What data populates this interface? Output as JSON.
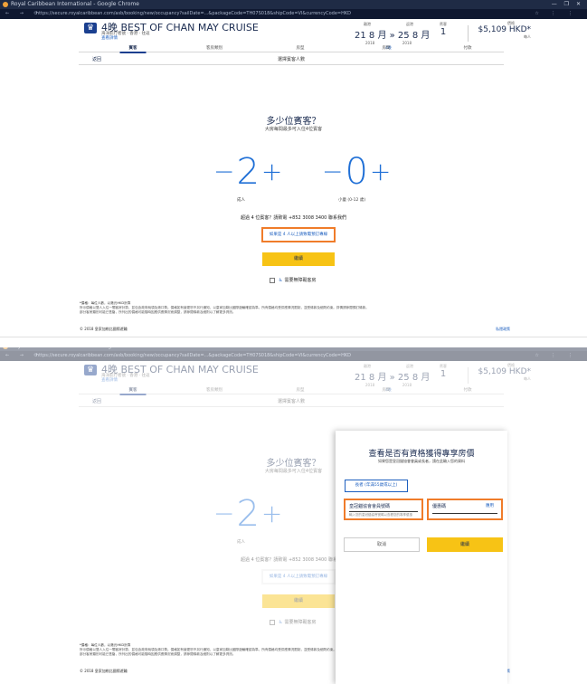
{
  "browser": {
    "window_title": "Royal Caribbean International - Google Chrome",
    "window_controls": "— ❐ ✕",
    "nav_glyphs": "← → ⟳",
    "url": "https://secure.royalcaribbean.com/asb/booking/new/occupancy?sailDate=...&packageCode=TH07S018&shipCode=VI&currencyCode=HKD",
    "address_icons": "☆ ⋮ ⋮"
  },
  "header": {
    "logo_glyph": "♛",
    "cruise_name": "4晚 BEST OF CHAN MAY CRUISE",
    "cruise_sub": "海洋航行者號 · 香港 · 往返",
    "details_link": "查看詳情",
    "date_labels": [
      "離港",
      "返港"
    ],
    "date_range": "21 8 月  »  25 8 月",
    "years": [
      "2018",
      "2018"
    ],
    "nights": "4晚",
    "guests_label": "賓客",
    "guests_value": "1",
    "price_label": "價格",
    "price_amount": "$5,109 HKD*",
    "price_per": "每人"
  },
  "steps": [
    "賓客",
    "客房類別",
    "房型",
    "房間",
    "付款"
  ],
  "subbar": {
    "back": "返回",
    "title": "選擇賓客人數"
  },
  "occupancy": {
    "title": "多少位賓客？",
    "subtitle": "大房每間最多可入住4位賓客",
    "adults": "2",
    "adults_label": "成人",
    "children": "0",
    "children_label": "小童 (0-12 歲)",
    "minus": "−",
    "plus": "+",
    "note": "超過 4 位賓客？請致電 +852 3008 3400 聯系我們",
    "link_button": "如果是 4 人以上請致電預訂專線",
    "continue": "繼續",
    "accessible": "需要無障礙客房"
  },
  "footer": {
    "line1": "*價格：每位人數，以港元HKD計算",
    "line2": "所示價格以雙人入住一間客房計算，並包含政府稅項及港口費。價格如有變更恕不另行通知，以皇家加勒比國際遊輪確認為準。所有價格均受供應情況限制，並受條款及細則約束。詳情請參閱預訂條款。",
    "line3": "部分客房類別可能已售罄，所列出的價格可能隨時因應供應情況而調整，請參閱條款及細則以了解更多資訊。",
    "copyright": "© 2018 皇家加勒比國際遊輪",
    "privacy": "私隱政策"
  },
  "drawer": {
    "title": "查看是否有資格獲得專享房價",
    "subtitle": "如果您是皇冠錨協會會員或長者，請在此輸入您的資料",
    "segment": "長者 (年滿55歲或以上)",
    "field_a_label": "皇冠錨協會會員號碼",
    "field_a_help": "輸入您的皇冠錨協會號碼以查看您的專享優惠",
    "field_b_label": "優惠碼",
    "field_b_apply": "應用",
    "cancel": "取消",
    "continue": "繼續"
  }
}
